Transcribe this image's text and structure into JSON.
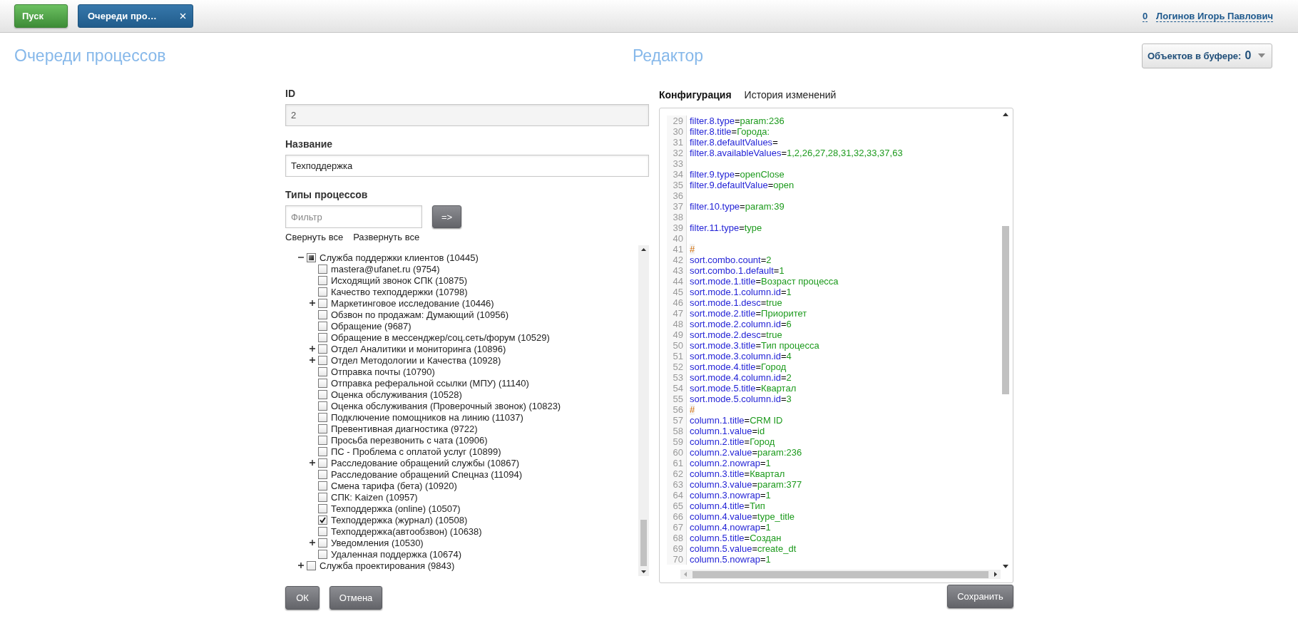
{
  "top_bar": {
    "start_button": "Пуск",
    "tabs": [
      {
        "label": "Очереди про…",
        "selected": true
      }
    ],
    "counter": "0",
    "user": "Логинов Игорь Павлович"
  },
  "headings": {
    "left": "Очереди процессов",
    "center": "Редактор"
  },
  "buffer": {
    "label": "Объектов в буфере:",
    "count": "0"
  },
  "form": {
    "fields": [
      {
        "label": "ID",
        "value": "2",
        "disabled": true
      },
      {
        "label": "Название",
        "value": "Техподдержка",
        "disabled": false
      }
    ],
    "types_label": "Типы процессов",
    "filter_placeholder": "Фильтр",
    "filter_button": "=>",
    "collapse_all": "Свернуть все",
    "expand_all": "Развернуть все",
    "tree": [
      {
        "label": "Служба поддержки клиентов (10445)",
        "kind": "branch",
        "checked": false,
        "partial": true,
        "expanded": true,
        "children": [
          {
            "label": "mastera@ufanet.ru (9754)",
            "kind": "leaf",
            "checked": false,
            "partial": false
          },
          {
            "label": "Исходящий звонок СПК (10875)",
            "kind": "leaf",
            "checked": false,
            "partial": false
          },
          {
            "label": "Качество техподдержки (10798)",
            "kind": "leaf",
            "checked": false,
            "partial": false
          },
          {
            "label": "Маркетинговое исследование (10446)",
            "kind": "branch",
            "checked": false,
            "partial": false,
            "expanded": false
          },
          {
            "label": "Обзвон по продажам: Думающий (10956)",
            "kind": "leaf",
            "checked": false,
            "partial": false
          },
          {
            "label": "Обращение (9687)",
            "kind": "leaf",
            "checked": false,
            "partial": false
          },
          {
            "label": "Обращение в мессенджер/соц.сеть/форум (10529)",
            "kind": "leaf",
            "checked": false,
            "partial": false
          },
          {
            "label": "Отдел Аналитики и мониторинга (10896)",
            "kind": "branch",
            "checked": false,
            "partial": false,
            "expanded": false
          },
          {
            "label": "Отдел Методологии и Качества (10928)",
            "kind": "branch",
            "checked": false,
            "partial": false,
            "expanded": false
          },
          {
            "label": "Отправка почты (10790)",
            "kind": "leaf",
            "checked": false,
            "partial": false
          },
          {
            "label": "Отправка реферальной ссылки (МПУ) (11140)",
            "kind": "leaf",
            "checked": false,
            "partial": false
          },
          {
            "label": "Оценка обслуживания (10528)",
            "kind": "leaf",
            "checked": false,
            "partial": false
          },
          {
            "label": "Оценка обслуживания (Проверочный звонок) (10823)",
            "kind": "leaf",
            "checked": false,
            "partial": false
          },
          {
            "label": "Подключение помощников на линию (11037)",
            "kind": "leaf",
            "checked": false,
            "partial": false
          },
          {
            "label": "Превентивная диагностика (9722)",
            "kind": "leaf",
            "checked": false,
            "partial": false
          },
          {
            "label": "Просьба перезвонить с чата (10906)",
            "kind": "leaf",
            "checked": false,
            "partial": false
          },
          {
            "label": "ПС - Проблема с оплатой услуг (10899)",
            "kind": "leaf",
            "checked": false,
            "partial": false
          },
          {
            "label": "Расследование обращений службы (10867)",
            "kind": "branch",
            "checked": false,
            "partial": false,
            "expanded": false
          },
          {
            "label": "Расследование обращений Спецназ (11094)",
            "kind": "leaf",
            "checked": false,
            "partial": false
          },
          {
            "label": "Смена тарифа (бета) (10920)",
            "kind": "leaf",
            "checked": false,
            "partial": false
          },
          {
            "label": "СПК: Kaizen (10957)",
            "kind": "leaf",
            "checked": false,
            "partial": false
          },
          {
            "label": "Техподдержка (online) (10507)",
            "kind": "leaf",
            "checked": false,
            "partial": false
          },
          {
            "label": "Техподдержка (журнал) (10508)",
            "kind": "leaf",
            "checked": true,
            "partial": false
          },
          {
            "label": "Техподдержка(автообзвон) (10638)",
            "kind": "leaf",
            "checked": false,
            "partial": false
          },
          {
            "label": "Уведомления (10530)",
            "kind": "branch",
            "checked": false,
            "partial": false,
            "expanded": false
          },
          {
            "label": "Удаленная поддержка (10674)",
            "kind": "leaf",
            "checked": false,
            "partial": false
          }
        ]
      },
      {
        "label": "Служба проектирования (9843)",
        "kind": "branch",
        "checked": false,
        "partial": false,
        "expanded": false
      }
    ],
    "ok_button": "ОК",
    "cancel_button": "Отмена"
  },
  "editor": {
    "tabs": [
      {
        "label": "Конфигурация",
        "selected": true
      },
      {
        "label": "История изменений",
        "selected": false
      }
    ],
    "lines": [
      {
        "num": "29",
        "kind": "pair",
        "text": "filter.8.type=param:236"
      },
      {
        "num": "30",
        "kind": "pair",
        "text": "filter.8.title=Города:"
      },
      {
        "num": "31",
        "kind": "pair",
        "text": "filter.8.defaultValues="
      },
      {
        "num": "32",
        "kind": "pair",
        "text": "filter.8.availableValues=1,2,26,27,28,31,32,33,37,63"
      },
      {
        "num": "33",
        "kind": "blank"
      },
      {
        "num": "34",
        "kind": "pair",
        "text": "filter.9.type=openClose"
      },
      {
        "num": "35",
        "kind": "pair",
        "text": "filter.9.defaultValue=open"
      },
      {
        "num": "36",
        "kind": "blank"
      },
      {
        "num": "37",
        "kind": "pair",
        "text": "filter.10.type=param:39"
      },
      {
        "num": "38",
        "kind": "blank"
      },
      {
        "num": "39",
        "kind": "pair",
        "text": "filter.11.type=type"
      },
      {
        "num": "40",
        "kind": "blank"
      },
      {
        "num": "41",
        "kind": "comment",
        "text": "#"
      },
      {
        "num": "42",
        "kind": "pair",
        "text": "sort.combo.count=2"
      },
      {
        "num": "43",
        "kind": "pair",
        "text": "sort.combo.1.default=1"
      },
      {
        "num": "44",
        "kind": "pair",
        "text": "sort.mode.1.title=Возраст процесса"
      },
      {
        "num": "45",
        "kind": "pair",
        "text": "sort.mode.1.column.id=1"
      },
      {
        "num": "46",
        "kind": "pair",
        "text": "sort.mode.1.desc=true"
      },
      {
        "num": "47",
        "kind": "pair",
        "text": "sort.mode.2.title=Приоритет"
      },
      {
        "num": "48",
        "kind": "pair",
        "text": "sort.mode.2.column.id=6"
      },
      {
        "num": "49",
        "kind": "pair",
        "text": "sort.mode.2.desc=true"
      },
      {
        "num": "50",
        "kind": "pair",
        "text": "sort.mode.3.title=Тип процесса"
      },
      {
        "num": "51",
        "kind": "pair",
        "text": "sort.mode.3.column.id=4"
      },
      {
        "num": "52",
        "kind": "pair",
        "text": "sort.mode.4.title=Город"
      },
      {
        "num": "53",
        "kind": "pair",
        "text": "sort.mode.4.column.id=2"
      },
      {
        "num": "54",
        "kind": "pair",
        "text": "sort.mode.5.title=Квартал"
      },
      {
        "num": "55",
        "kind": "pair",
        "text": "sort.mode.5.column.id=3"
      },
      {
        "num": "56",
        "kind": "comment",
        "text": "#"
      },
      {
        "num": "57",
        "kind": "pair",
        "text": "column.1.title=CRM ID"
      },
      {
        "num": "58",
        "kind": "pair",
        "text": "column.1.value=id"
      },
      {
        "num": "59",
        "kind": "pair",
        "text": "column.2.title=Город"
      },
      {
        "num": "60",
        "kind": "pair",
        "text": "column.2.value=param:236"
      },
      {
        "num": "61",
        "kind": "pair",
        "text": "column.2.nowrap=1"
      },
      {
        "num": "62",
        "kind": "pair",
        "text": "column.3.title=Квартал"
      },
      {
        "num": "63",
        "kind": "pair",
        "text": "column.3.value=param:377"
      },
      {
        "num": "64",
        "kind": "pair",
        "text": "column.3.nowrap=1"
      },
      {
        "num": "65",
        "kind": "pair",
        "text": "column.4.title=Тип"
      },
      {
        "num": "66",
        "kind": "pair",
        "text": "column.4.value=type_title"
      },
      {
        "num": "67",
        "kind": "pair",
        "text": "column.4.nowrap=1"
      },
      {
        "num": "68",
        "kind": "pair",
        "text": "column.5.title=Создан"
      },
      {
        "num": "69",
        "kind": "pair",
        "text": "column.5.value=create_dt"
      },
      {
        "num": "70",
        "kind": "pair",
        "text": "column.5.nowrap=1"
      }
    ],
    "save_button": "Сохранить"
  }
}
